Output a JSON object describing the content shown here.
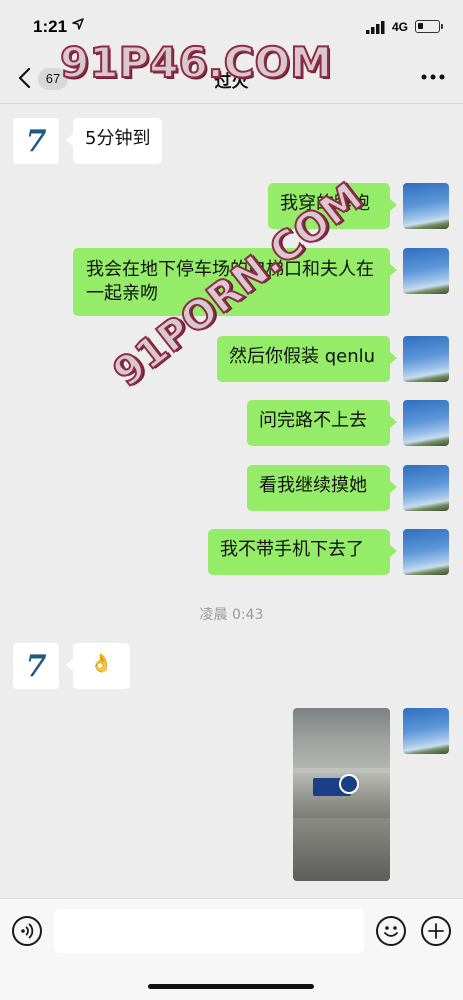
{
  "status_bar": {
    "time": "1:21",
    "network": "4G"
  },
  "nav": {
    "unread_count": "67",
    "title": "过火"
  },
  "messages": [
    {
      "side": "in",
      "text": "5分钟到"
    },
    {
      "side": "out",
      "text": "我穿的睡袍"
    },
    {
      "side": "out",
      "text": "我会在地下停车场的电梯口和夫人在一起亲吻"
    },
    {
      "side": "out",
      "text": "然后你假装 qenlu"
    },
    {
      "side": "out",
      "text": "问完路不上去"
    },
    {
      "side": "out",
      "text": "看我继续摸她"
    },
    {
      "side": "out",
      "text": "我不带手机下去了"
    },
    {
      "side": "in",
      "text": "👌"
    }
  ],
  "time_divider": "凌晨 0:43",
  "avatars": {
    "contact_letter": "7"
  },
  "video_message": {
    "thumbnail": "parking-garage-video"
  },
  "watermark": {
    "top": "91P46.COM",
    "diagonal": "91PORN.COM"
  },
  "icons": {
    "back": "chevron-left-icon",
    "more": "ellipsis-icon",
    "voice": "voice-icon",
    "emoji": "emoji-icon",
    "plus": "plus-icon"
  },
  "colors": {
    "outgoing_bubble": "#95ec69",
    "incoming_bubble": "#ffffff",
    "background": "#ededed"
  }
}
